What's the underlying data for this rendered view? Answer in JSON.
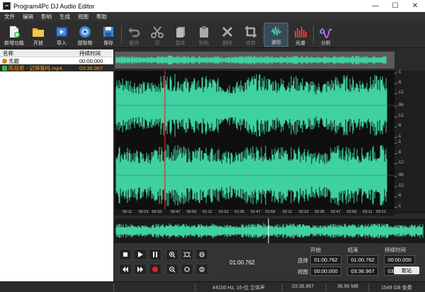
{
  "window": {
    "title": "Program4Pc DJ Audio Editor",
    "minimize": "—",
    "maximize": "☐",
    "close": "✕"
  },
  "menu": [
    "文件",
    "编辑",
    "影响",
    "生成",
    "视图",
    "帮助"
  ],
  "toolbar": {
    "new": "新增功能",
    "open": "开放",
    "import": "导入",
    "extract": "提取物",
    "save": "保存",
    "undo": "撤消",
    "cut": "切",
    "copy": "副本",
    "paste": "粘贴",
    "delete": "删除",
    "trim": "修剪",
    "waveform": "波形",
    "spectrum": "光谱",
    "analyze": "分析"
  },
  "filelist": {
    "col_name": "名称",
    "col_duration": "持续时间",
    "rows": [
      {
        "name": "无题",
        "duration": "00:00:000",
        "selected": false
      },
      {
        "name": "陈冠希 - 记得我吗.mp4",
        "duration": "03:36.967",
        "selected": true
      }
    ]
  },
  "scale_labels": [
    "-1",
    "-6",
    "-12",
    "-96",
    "-12",
    "-6",
    "-1",
    "-1",
    "-6",
    "-12",
    "-96",
    "-12",
    "-6",
    "-1"
  ],
  "timeline": [
    "00:11",
    "00:23",
    "00:33",
    "00:47",
    "00:59",
    "01:11",
    "01:23",
    "01:35",
    "01:47",
    "01:58",
    "02:11",
    "02:23",
    "02:35",
    "02:47",
    "02:59",
    "03:11",
    "03:21"
  ],
  "playhead_time": "00:39",
  "panel": {
    "current_time": "01:00.762",
    "start_label": "开始",
    "end_label": "结束",
    "duration_label": "持续时间",
    "select_label": "选择",
    "view_label": "视图",
    "select_start": "01:00.762",
    "select_end": "01:00.762",
    "select_duration": "00:00.000",
    "view_start": "00:00.000",
    "view_end": "03:36.967",
    "view_duration": "03:36.967",
    "tray_label": "数站"
  },
  "status": {
    "format": "44100 Hz, 16-位 立体声",
    "length": "03:36.967",
    "size": "36.90 MB",
    "free": "1549 GB 免费"
  },
  "colors": {
    "wave": "#3fd1a0",
    "playhead": "#d02a2a",
    "accent": "#ff9f1a"
  }
}
